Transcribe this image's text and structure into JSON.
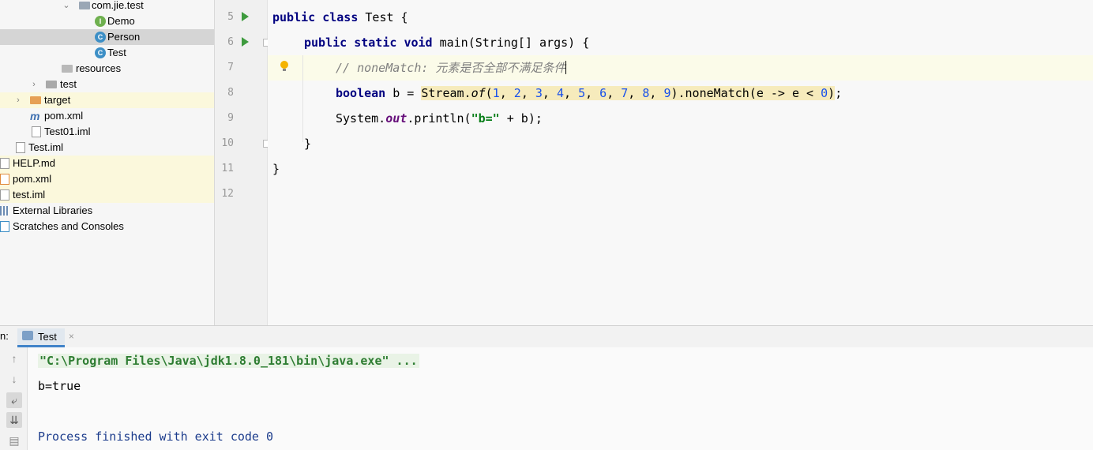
{
  "tree": {
    "items": [
      {
        "label": "com.jie.test",
        "kind": "package"
      },
      {
        "label": "Demo",
        "kind": "interface",
        "badge": "I"
      },
      {
        "label": "Person",
        "kind": "class",
        "badge": "C",
        "selected": true
      },
      {
        "label": "Test",
        "kind": "class",
        "badge": "C"
      },
      {
        "label": "resources",
        "kind": "folder"
      },
      {
        "label": "test",
        "kind": "folder"
      },
      {
        "label": "target",
        "kind": "folder"
      },
      {
        "label": "pom.xml",
        "kind": "maven"
      },
      {
        "label": "Test01.iml",
        "kind": "file"
      },
      {
        "label": "Test.iml",
        "kind": "file"
      },
      {
        "label": "HELP.md",
        "kind": "file"
      },
      {
        "label": "pom.xml",
        "kind": "file"
      },
      {
        "label": "test.iml",
        "kind": "file"
      },
      {
        "label": "External Libraries",
        "kind": "libraries"
      },
      {
        "label": "Scratches and Consoles",
        "kind": "scratches"
      }
    ]
  },
  "editor": {
    "line_numbers": [
      "5",
      "6",
      "7",
      "8",
      "9",
      "10",
      "11",
      "12"
    ],
    "line5": {
      "kw1": "public",
      "kw2": "class",
      "name": " Test {"
    },
    "line6": {
      "kw1": "public",
      "kw2": "static",
      "kw3": "void",
      "rest": " main(String[] args) {"
    },
    "line7": {
      "comment": "// noneMatch: 元素是否全部不满足条件"
    },
    "line8": {
      "kw": "boolean",
      "pre": " b = ",
      "hl_start": "Stream.",
      "of": "of",
      "args_open": "(",
      "nums": [
        "1",
        "2",
        "3",
        "4",
        "5",
        "6",
        "7",
        "8",
        "9"
      ],
      "mid": ").noneMatch(e -> e < ",
      "zero": "0",
      "hl_end": ")",
      "end": ";"
    },
    "line9": {
      "pre": "System.",
      "out": "out",
      "mid": ".println(",
      "str": "\"b=\"",
      "end": " + b);"
    },
    "line10": {
      "text": "}"
    },
    "line11": {
      "text": "}"
    }
  },
  "run": {
    "prefix": "n:",
    "tab_label": "Test",
    "console": {
      "cmd": "\"C:\\Program Files\\Java\\jdk1.8.0_181\\bin\\java.exe\" ...",
      "output": "b=true",
      "finished": "Process finished with exit code 0"
    }
  },
  "colors": {
    "keyword": "#000080",
    "number": "#1750eb",
    "string": "#067d17",
    "comment": "#808080",
    "run_green": "#3e9b3e",
    "selection": "#d5d5d5"
  }
}
